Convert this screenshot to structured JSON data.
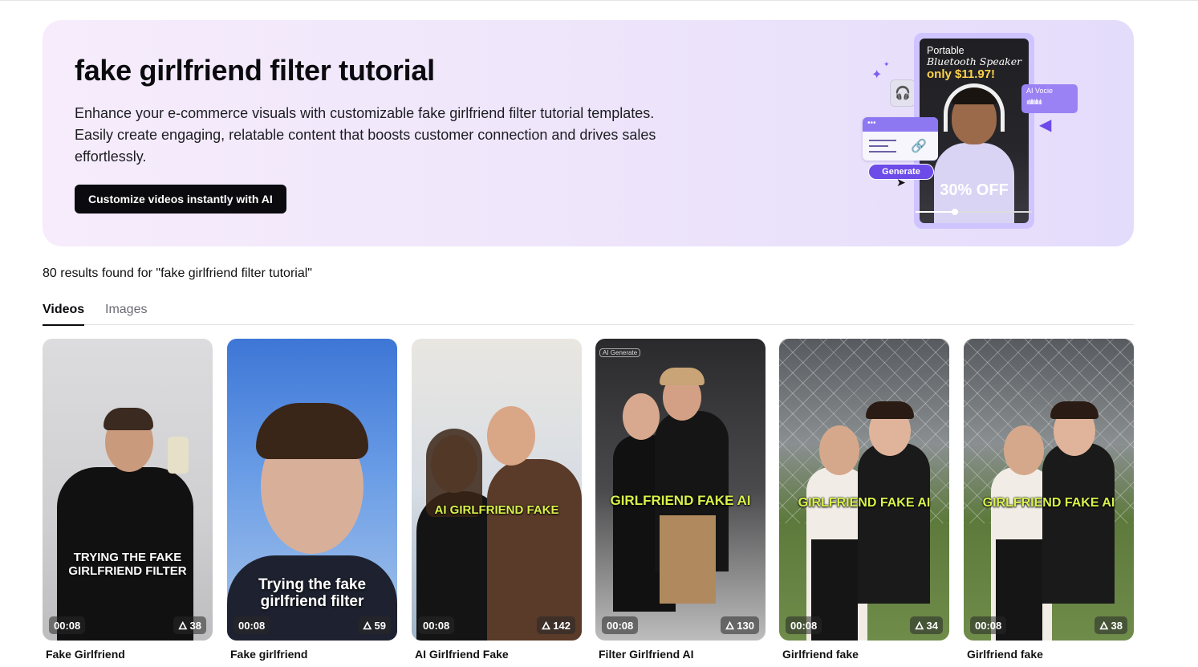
{
  "banner": {
    "title": "fake girlfriend filter tutorial",
    "description": "Enhance your e-commerce visuals with customizable fake girlfriend filter tutorial templates. Easily create engaging, relatable content that boosts customer connection and drives sales effortlessly.",
    "cta_label": "Customize videos instantly with AI",
    "illustration": {
      "product_line1": "Portable",
      "product_line2": "Bluetooth Speaker",
      "price": "only $11.97!",
      "discount": "30% OFF",
      "generate_label": "Generate",
      "voice_label": "AI Vocie",
      "menu_dots": "•••"
    }
  },
  "results": {
    "summary": "80 results found for \"fake girlfriend filter tutorial\""
  },
  "tabs": [
    {
      "label": "Videos",
      "active": true
    },
    {
      "label": "Images",
      "active": false
    }
  ],
  "icons": {
    "views": "flame-icon",
    "link": "link-icon",
    "sparkle": "sparkle-icon",
    "arrow": "arrow-icon",
    "cursor": "cursor-icon"
  },
  "videos": [
    {
      "title": "Fake Girlfriend",
      "duration": "00:08",
      "views": "38",
      "overlay": "TRYING THE FAKE GIRLFRIEND FILTER",
      "tag": ""
    },
    {
      "title": "Fake girlfriend",
      "duration": "00:08",
      "views": "59",
      "overlay": "Trying the fake girlfriend filter",
      "tag": ""
    },
    {
      "title": "AI Girlfriend Fake",
      "duration": "00:08",
      "views": "142",
      "overlay": "AI GIRLFRIEND FAKE",
      "tag": ""
    },
    {
      "title": "Filter Girlfriend AI",
      "duration": "00:08",
      "views": "130",
      "overlay": "GIRLFRIEND FAKE AI",
      "tag": "AI Generate"
    },
    {
      "title": "Girlfriend fake",
      "duration": "00:08",
      "views": "34",
      "overlay": "GIRLFRIEND FAKE AI",
      "tag": ""
    },
    {
      "title": "Girlfriend fake",
      "duration": "00:08",
      "views": "38",
      "overlay": "GIRLFRIEND FAKE AI",
      "tag": ""
    }
  ],
  "colors": {
    "accent": "#6c4be8",
    "overlay_yellow": "#d9f24a",
    "banner_bg": "#efe6fb"
  }
}
